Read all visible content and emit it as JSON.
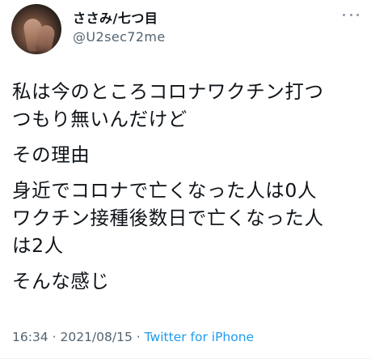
{
  "author": {
    "display_name": "ささみ/七つ目",
    "handle": "@U2sec72me"
  },
  "tweet": {
    "paragraphs": [
      "私は今のところコロナワクチン打つ\nつもり無いんだけど",
      "その理由",
      "身近でコロナで亡くなった人は0人\nワクチン接種後数日で亡くなった人\nは2人",
      "そんな感じ"
    ],
    "time": "16:34",
    "date": "2021/08/15",
    "separator": "·",
    "source": "Twitter for iPhone"
  },
  "icons": {
    "more": "more-options-icon",
    "avatar": "avatar-photo"
  },
  "colors": {
    "text": "#0f1419",
    "secondary": "#536471",
    "link": "#1d9bf0"
  }
}
